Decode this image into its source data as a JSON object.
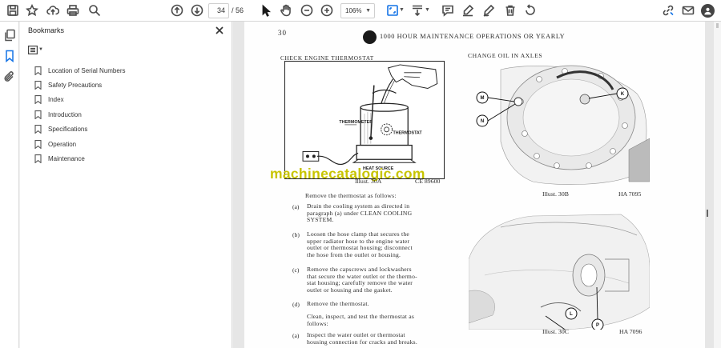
{
  "toolbar": {
    "current_page": "34",
    "page_separator": "/",
    "total_pages": "56",
    "zoom": "106%"
  },
  "bookmarks_panel": {
    "title": "Bookmarks",
    "items": [
      {
        "label": "Location of Serial Numbers"
      },
      {
        "label": "Safety Precautions"
      },
      {
        "label": "Index"
      },
      {
        "label": "Introduction"
      },
      {
        "label": "Specifications"
      },
      {
        "label": "Operation"
      },
      {
        "label": "Maintenance"
      }
    ]
  },
  "document": {
    "page_number": "30",
    "heading": "1000 HOUR MAINTENANCE OPERATIONS OR YEARLY",
    "section_left": "CHECK ENGINE THERMOSTAT",
    "section_right": "CHANGE OIL IN AXLES",
    "illus_a": {
      "labels": {
        "thermometer": "THERMOMETER",
        "thermostat": "THERMOSTAT",
        "heat_source": "HEAT SOURCE"
      },
      "caption": "Illust. 30A",
      "code": "CE 89600"
    },
    "watermark": "machinecatalogic.com",
    "intro": "Remove the thermostat as follows:",
    "steps": [
      {
        "mark": "(a)",
        "lines": [
          "Drain the cooling system as directed in",
          "paragraph (a) under CLEAN COOLING",
          "SYSTEM."
        ]
      },
      {
        "mark": "(b)",
        "lines": [
          "Loosen the hose clamp that secures the",
          "upper radiator hose to the engine water",
          "outlet or thermostat housing; disconnect",
          "the hose from the outlet or housing."
        ]
      },
      {
        "mark": "(c)",
        "lines": [
          "Remove the capscrews and lockwashers",
          "that secure the water outlet or the thermo-",
          "stat housing; carefully remove the water",
          "outlet or housing and the gasket."
        ]
      },
      {
        "mark": "(d)",
        "lines": [
          "Remove the thermostat."
        ]
      }
    ],
    "para2": [
      "Clean, inspect, and test the thermostat as",
      "follows:"
    ],
    "step2": {
      "mark": "(a)",
      "lines": [
        "Inspect the water outlet or thermostat",
        "housing connection for cracks and breaks."
      ]
    },
    "illus_b": {
      "callouts": [
        "M",
        "N",
        "K"
      ],
      "caption": "Illust. 30B",
      "code": "HA 7095"
    },
    "illus_c": {
      "callouts": [
        "P",
        "L"
      ],
      "caption": "Illust. 30C",
      "code": "HA 7096"
    }
  }
}
